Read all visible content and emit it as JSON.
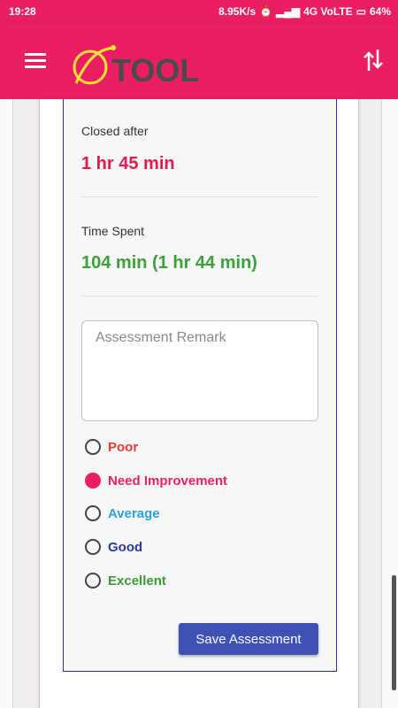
{
  "status_bar": {
    "time": "19:28",
    "network_speed": "8.95K/s",
    "network_type": "4G VoLTE",
    "battery": "64%"
  },
  "app_bar": {
    "logo_text": "TOOL",
    "menu_icon": "hamburger-icon",
    "sort_icon": "sort-arrows-icon"
  },
  "details": {
    "closed_after_label": "Closed after",
    "closed_after_value": "1 hr 45 min",
    "time_spent_label": "Time Spent",
    "time_spent_value": "104 min (1 hr 44 min)"
  },
  "assessment": {
    "remark_placeholder": "Assessment Remark",
    "remark_value": "",
    "options": [
      {
        "label": "Poor",
        "color": "#e53935",
        "checked": false
      },
      {
        "label": "Need Improvement",
        "color": "#e91e63",
        "checked": true
      },
      {
        "label": "Average",
        "color": "#29a3e0",
        "checked": false
      },
      {
        "label": "Good",
        "color": "#2b3a9b",
        "checked": false
      },
      {
        "label": "Excellent",
        "color": "#3a9a3a",
        "checked": false
      }
    ],
    "save_label": "Save Assessment"
  },
  "colors": {
    "primary": "#e91e63",
    "closed_after": "#e0194f",
    "time_spent": "#3aa03a",
    "button": "#3f51b5"
  }
}
